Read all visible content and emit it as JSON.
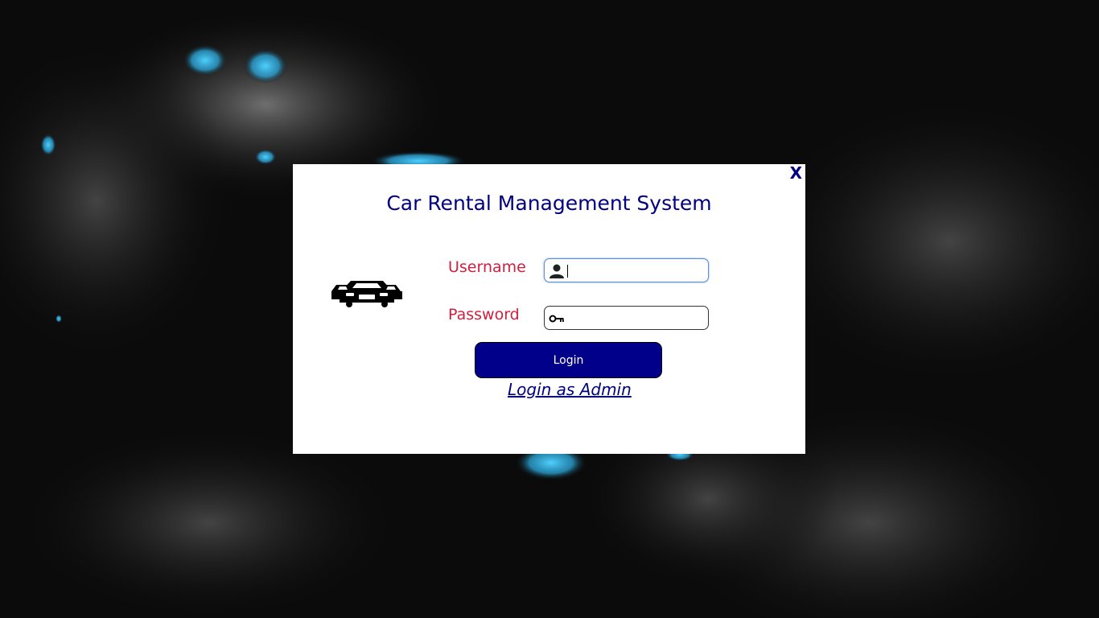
{
  "dialog": {
    "close_label": "X",
    "title": "Car Rental Management System",
    "username_label": "Username",
    "password_label": "Password",
    "username_value": "",
    "password_value": "",
    "login_button": "Login",
    "admin_link": "Login as Admin"
  },
  "icons": {
    "logo": "cars-icon",
    "username": "user-icon",
    "password": "key-icon"
  },
  "colors": {
    "title": "#000080",
    "labels": "#d21f3c",
    "button_bg": "#00008b",
    "accent_highlight": "#2fb4e8"
  }
}
